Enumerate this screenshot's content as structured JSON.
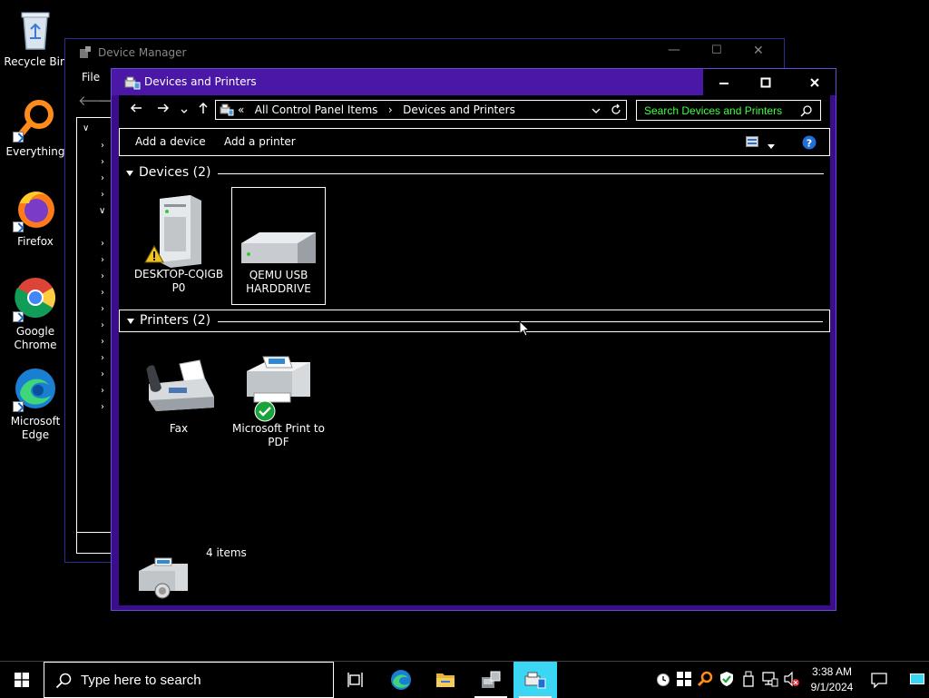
{
  "desktop": {
    "icons": [
      {
        "label": "Recycle Bin"
      },
      {
        "label": "Everything"
      },
      {
        "label": "Firefox"
      },
      {
        "label": "Google Chrome"
      },
      {
        "label": "Microsoft Edge"
      }
    ]
  },
  "device_manager": {
    "title": "Device Manager",
    "menu_file": "File"
  },
  "devices_printers": {
    "title": "Devices and Printers",
    "breadcrumb": {
      "overflow": "«",
      "parent": "All Control Panel Items",
      "separator": "›",
      "current": "Devices and Printers"
    },
    "search_placeholder": "Search Devices and Printers",
    "commands": {
      "add_device": "Add a device",
      "add_printer": "Add a printer"
    },
    "groups": {
      "devices": {
        "header": "Devices (2)",
        "items": [
          {
            "label": "DESKTOP-CQIGB P0"
          },
          {
            "label": "QEMU USB HARDDRIVE"
          }
        ]
      },
      "printers": {
        "header": "Printers (2)",
        "items": [
          {
            "label": "Fax"
          },
          {
            "label": "Microsoft Print to PDF"
          }
        ]
      }
    },
    "status": "4 items"
  },
  "taskbar": {
    "search_placeholder": "Type here to search",
    "clock_time": "3:38 AM",
    "clock_date": "9/1/2024"
  },
  "colors": {
    "accent": "#4b17a6",
    "window_border": "#3a0d8c",
    "search_text": "#3dff3d",
    "selection": "#3cd6f5"
  }
}
